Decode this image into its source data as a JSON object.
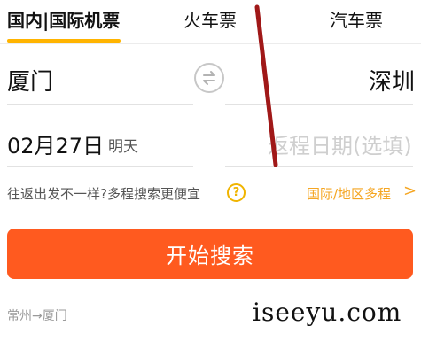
{
  "tabs": {
    "domestic_international": "国内|国际机票",
    "train": "火车票",
    "bus": "汽车票"
  },
  "route": {
    "from_city": "厦门",
    "to_city": "深圳"
  },
  "dates": {
    "depart": "02月27日",
    "depart_relative": "明天",
    "return_placeholder": "返程日期(选填)"
  },
  "hint": {
    "text": "往返出发不一样?多程搜索更便宜",
    "help_icon": "?",
    "multi_trip_link": "国际/地区多程",
    "chevron": ">"
  },
  "search_button": "开始搜索",
  "history": {
    "recent": "常州→厦门"
  },
  "watermark": "iseeyu.com",
  "colors": {
    "accent_orange": "#ff5a1f",
    "tab_underline": "#ffb400",
    "link_orange": "#f5a623",
    "annotation_arrow": "#a01818"
  },
  "icons": {
    "swap": "swap-arrows-icon",
    "help": "question-circle-icon",
    "chevron": "chevron-right-icon",
    "annotation": "annotation-arrow"
  }
}
